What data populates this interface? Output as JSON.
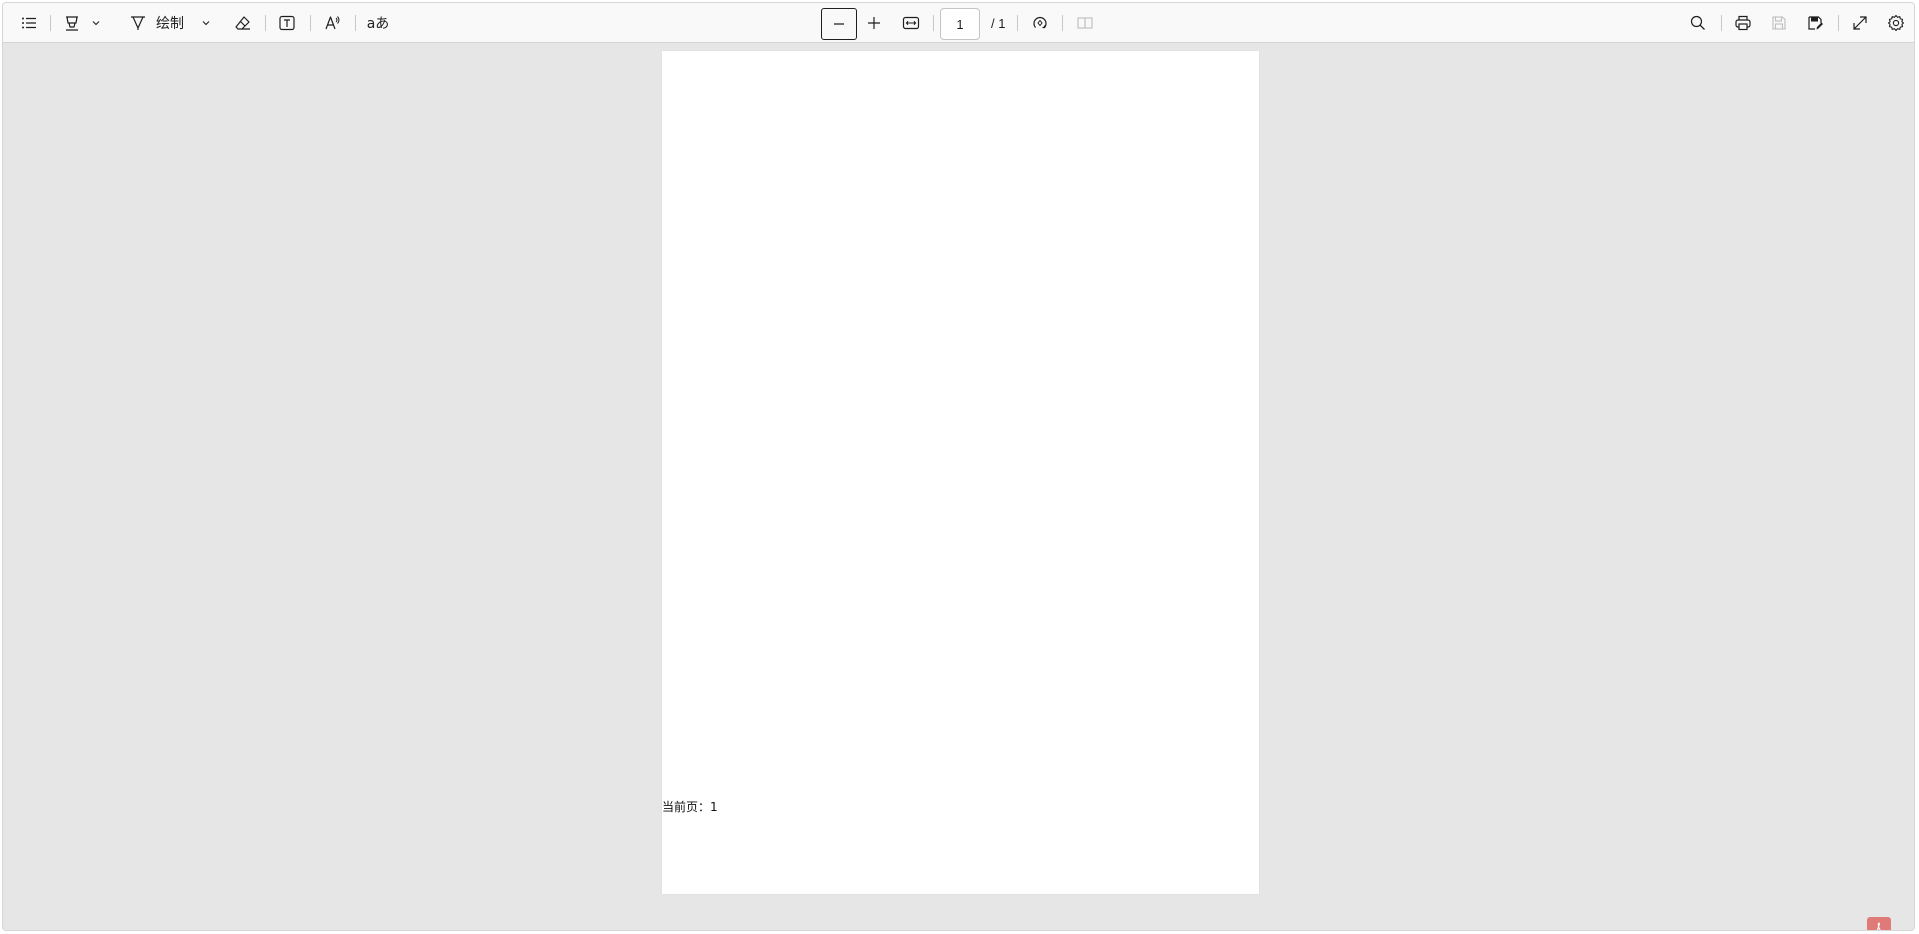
{
  "toolbar": {
    "left": {
      "outline_icon": "list-icon",
      "highlight_icon": "highlighter-icon",
      "highlight_dropdown_icon": "chevron-down-icon",
      "draw_icon": "draw-pen-icon",
      "draw_label": "绘制",
      "draw_dropdown_icon": "chevron-down-icon",
      "eraser_icon": "eraser-icon",
      "textbox_icon": "text-box-icon",
      "read_aloud_icon": "read-aloud-icon",
      "translate_label": "aあ"
    },
    "center": {
      "zoom_out_icon": "minus-icon",
      "zoom_in_icon": "plus-icon",
      "fit_width_icon": "fit-width-icon",
      "page_number": "1",
      "page_total": "/ 1",
      "rotate_icon": "rotate-icon",
      "page_view_icon": "page-view-icon"
    },
    "right": {
      "search_icon": "search-icon",
      "print_icon": "print-icon",
      "save_icon": "save-icon",
      "save_as_icon": "save-as-icon",
      "fullscreen_icon": "expand-icon",
      "settings_icon": "gear-icon"
    }
  },
  "document": {
    "page_indicator": "当前页：1"
  },
  "colors": {
    "toolbar_bg": "#f9f9f9",
    "viewer_bg": "#e6e6e6",
    "page_bg": "#ffffff",
    "pdf_badge": "#e07a78"
  }
}
